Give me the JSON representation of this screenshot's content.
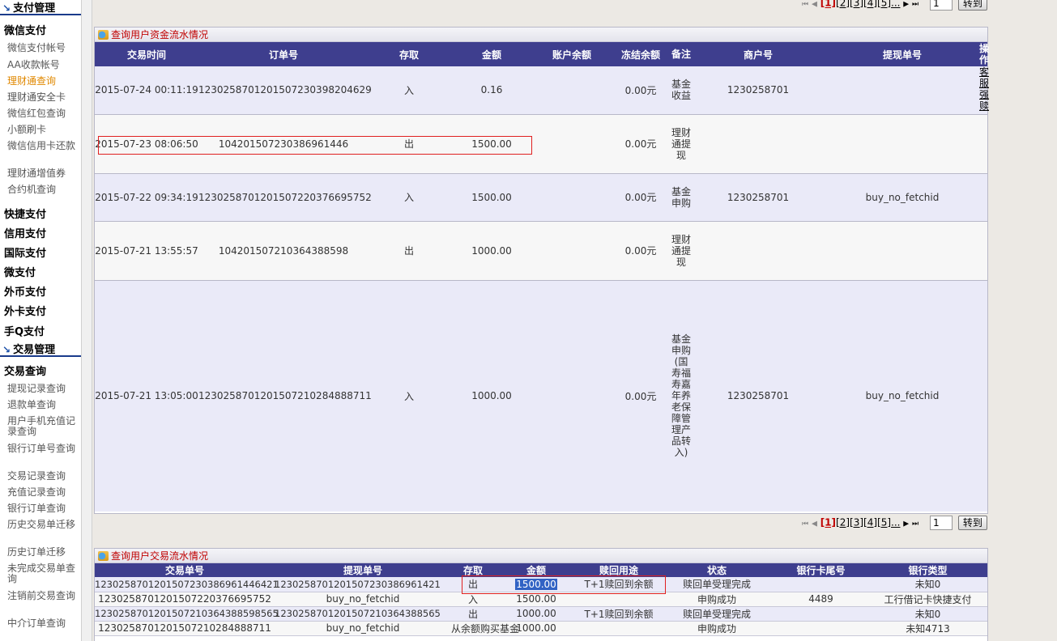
{
  "sidebar": {
    "section1": "支付管理",
    "group_weixin": "微信支付",
    "weixin_items": [
      "微信支付帐号",
      "AA收款帐号",
      "理财通查询",
      "理财通安全卡",
      "微信红包查询",
      "小额刷卡",
      "微信信用卡还款",
      "理财通增值券",
      "合约机查询"
    ],
    "active_item": "理财通查询",
    "groups": [
      "快捷支付",
      "信用支付",
      "国际支付",
      "微支付",
      "外币支付",
      "外卡支付",
      "手Q支付"
    ],
    "section2": "交易管理",
    "group_trade": "交易查询",
    "trade_items": [
      "提现记录查询",
      "退款单查询",
      "用户手机充值记录查询",
      "银行订单号查询",
      "交易记录查询",
      "充值记录查询",
      "银行订单查询",
      "历史交易单迁移",
      "历史订单迁移",
      "未完成交易单查询",
      "注销前交易查询",
      "中介订单查询"
    ]
  },
  "top_pager": {
    "current": "[1]",
    "pages": [
      "[2]",
      "[3]",
      "[4]",
      "[5]..."
    ],
    "input_value": "1",
    "go_label": "转到"
  },
  "flow_panel": {
    "title": "查询用户资金流水情况",
    "headers": [
      "交易时间",
      "订单号",
      "存取",
      "金额",
      "账户余额",
      "冻结余额",
      "备注",
      "商户号",
      "提现单号",
      "操作"
    ],
    "op_link": "客服强赎",
    "rows": [
      {
        "time": "2015-07-24 00:11:19",
        "order": "1230258701201507230398204629",
        "io": "入",
        "amount": "0.16",
        "balance": "",
        "frozen": "0.00元",
        "note": "基金收益",
        "merchant": "1230258701",
        "withdraw": ""
      },
      {
        "time": "2015-07-23 08:06:50",
        "order": "104201507230386961446",
        "io": "出",
        "amount": "1500.00",
        "balance": "",
        "frozen": "0.00元",
        "note": "理财通提现",
        "merchant": "",
        "withdraw": ""
      },
      {
        "time": "2015-07-22 09:34:19",
        "order": "1230258701201507220376695752",
        "io": "入",
        "amount": "1500.00",
        "balance": "",
        "frozen": "0.00元",
        "note": "基金申购",
        "merchant": "1230258701",
        "withdraw": "buy_no_fetchid"
      },
      {
        "time": "2015-07-21 13:55:57",
        "order": "104201507210364388598",
        "io": "出",
        "amount": "1000.00",
        "balance": "",
        "frozen": "0.00元",
        "note": "理财通提现",
        "merchant": "",
        "withdraw": ""
      },
      {
        "time": "2015-07-21 13:05:00",
        "order": "1230258701201507210284888711",
        "io": "入",
        "amount": "1000.00",
        "balance": "",
        "frozen": "0.00元",
        "note": "基金申购(国寿福寿嘉年养老保障管理产品转入)",
        "merchant": "1230258701",
        "withdraw": "buy_no_fetchid"
      }
    ]
  },
  "bottom_pager": {
    "current": "[1]",
    "pages": [
      "[2]",
      "[3]",
      "[4]",
      "[5]..."
    ],
    "input_value": "1",
    "go_label": "转到"
  },
  "trade_panel": {
    "title": "查询用户交易流水情况",
    "headers": [
      "交易单号",
      "提现单号",
      "存取",
      "金额",
      "赎回用途",
      "状态",
      "银行卡尾号",
      "银行类型"
    ],
    "rows": [
      {
        "trade_no": "1230258701201507230386961446421",
        "withdraw_no": "1230258701201507230386961421",
        "io": "出",
        "amount": "1500.00",
        "use": "T+1赎回到余额",
        "status": "赎回单受理完成",
        "card_tail": "",
        "bank": "未知0"
      },
      {
        "trade_no": "1230258701201507220376695752",
        "withdraw_no": "buy_no_fetchid",
        "io": "入",
        "amount": "1500.00",
        "use": "",
        "status": "申购成功",
        "card_tail": "4489",
        "bank": "工行借记卡快捷支付"
      },
      {
        "trade_no": "1230258701201507210364388598565",
        "withdraw_no": "1230258701201507210364388565",
        "io": "出",
        "amount": "1000.00",
        "use": "T+1赎回到余额",
        "status": "赎回单受理完成",
        "card_tail": "",
        "bank": "未知0"
      },
      {
        "trade_no": "1230258701201507210284888711",
        "withdraw_no": "buy_no_fetchid",
        "io": "从余额购买基金",
        "amount": "1000.00",
        "use": "",
        "status": "申购成功",
        "card_tail": "",
        "bank": "未知4713"
      }
    ]
  },
  "colors": {
    "header_bg": "#3e3e8e",
    "row_odd": "#eaeaf8",
    "row_even": "#f7f7f7",
    "title_red": "#c00000",
    "active_orange": "#e08800",
    "highlight_box": "#e02020"
  }
}
